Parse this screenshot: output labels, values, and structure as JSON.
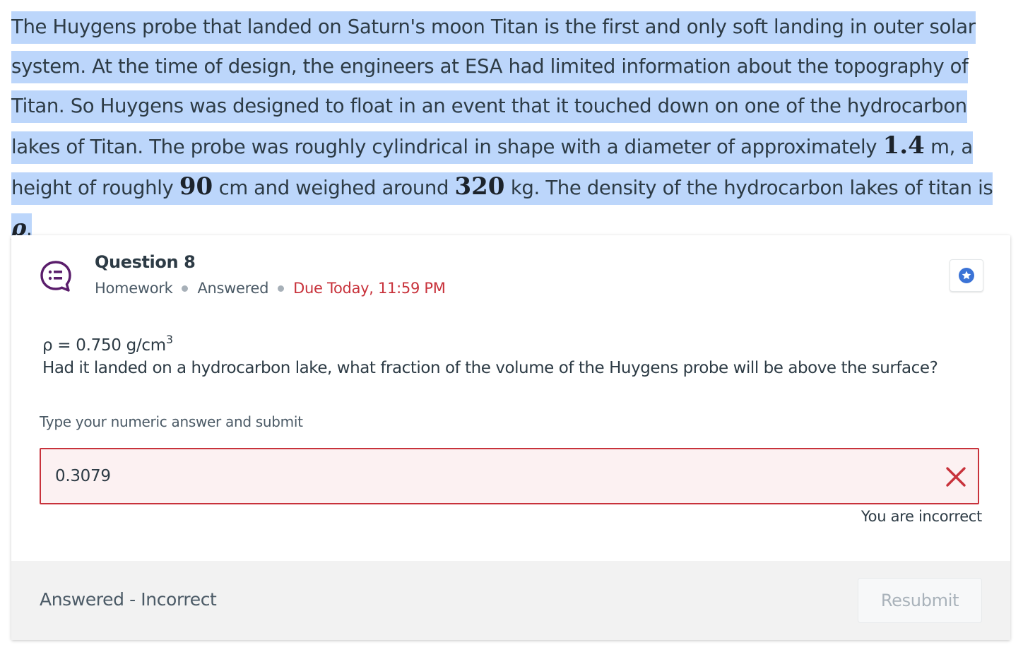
{
  "passage": {
    "l1": "The Huygens probe that landed on Saturn's moon Titan is the first and only soft landing in outer solar system. At the time of design, the engineers at ESA had limited information about the topography of Titan. So Huygens was designed to float in an event that it touched down on one of the hydrocarbon lakes of Titan. The probe was roughly cylindrical in shape with a diameter of approximately ",
    "diameter": "1.4",
    "l2": " m, a height of roughly ",
    "height": "90",
    "l3": " cm and weighed around ",
    "mass": "320",
    "l4": " kg. The density of the hydrocarbon lakes of titan is ",
    "rho_symbol": "ρ",
    "l5": "."
  },
  "question": {
    "title": "Question 8",
    "type": "Homework",
    "status": "Answered",
    "due": "Due Today, 11:59 PM",
    "rho_given": "ρ = 0.750 g/cm",
    "rho_exp": "3",
    "text": "Had it landed on a hydrocarbon lake, what fraction of the volume of the Huygens probe will be above the surface?"
  },
  "answer": {
    "label": "Type your numeric answer and submit",
    "value": "0.3079",
    "feedback": "You are incorrect"
  },
  "footer": {
    "status": "Answered - Incorrect",
    "resubmit_label": "Resubmit"
  },
  "colors": {
    "highlight": "#bcd6fb",
    "error": "#c8323b",
    "star": "#3b73d6",
    "icon": "#5a1d6b"
  },
  "icons": {
    "question": "chat-bubble-list-icon",
    "bookmark": "star-icon",
    "incorrect": "x-icon"
  }
}
